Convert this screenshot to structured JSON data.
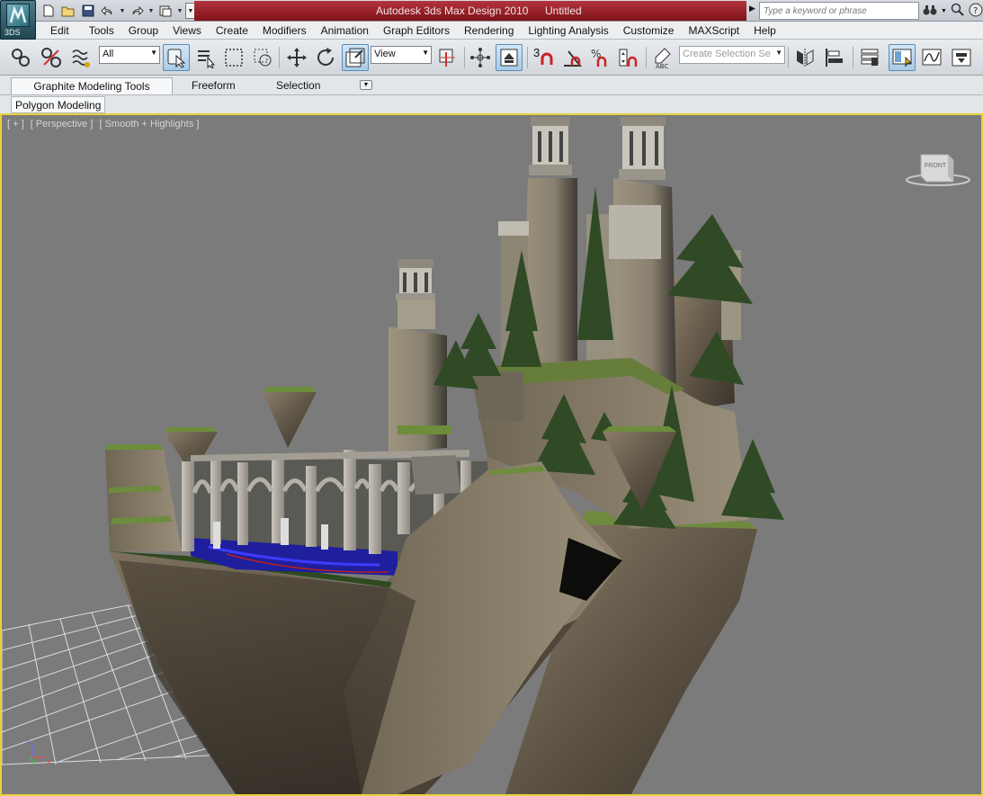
{
  "app": {
    "title": "Autodesk 3ds Max Design 2010",
    "document": "Untitled",
    "badge": "3DS"
  },
  "search": {
    "placeholder": "Type a keyword or phrase"
  },
  "menu": [
    "Edit",
    "Tools",
    "Group",
    "Views",
    "Create",
    "Modifiers",
    "Animation",
    "Graph Editors",
    "Rendering",
    "Lighting Analysis",
    "Customize",
    "MAXScript",
    "Help"
  ],
  "toolbar": {
    "filter_value": "All",
    "ref_coord_value": "View",
    "selection_set_placeholder": "Create Selection Se",
    "snap_label": "3",
    "icons": [
      "link-icon",
      "unlink-icon",
      "bind-space-warp-icon",
      "select-object-icon",
      "select-by-name-icon",
      "rectangular-selection-icon",
      "window-crossing-icon",
      "move-icon",
      "rotate-icon",
      "scale-icon",
      "pivot-icon",
      "manipulate-icon",
      "keyboard-shortcut-icon",
      "snaps-icon",
      "angle-snap-icon",
      "percent-snap-icon",
      "spinner-snap-icon",
      "edit-named-selection-icon",
      "mirror-icon",
      "align-icon",
      "layer-manager-icon",
      "graphite-toggle-icon",
      "curve-editor-icon",
      "schematic-view-icon"
    ]
  },
  "ribbon": {
    "tabs": [
      "Graphite Modeling Tools",
      "Freeform",
      "Selection"
    ],
    "panel": "Polygon Modeling"
  },
  "viewport": {
    "labels": [
      "[ + ]",
      "[ Perspective ]",
      "[ Smooth + Highlights ]"
    ],
    "viewcube_face": "FRONT",
    "axis": {
      "z": "z",
      "y": "y",
      "x": "x"
    },
    "border_color": "#e6d23a",
    "background_color": "#7b7b7b"
  },
  "colors": {
    "title_red": "#9b1f27",
    "active_tool_blue": "#a9cbe7"
  }
}
